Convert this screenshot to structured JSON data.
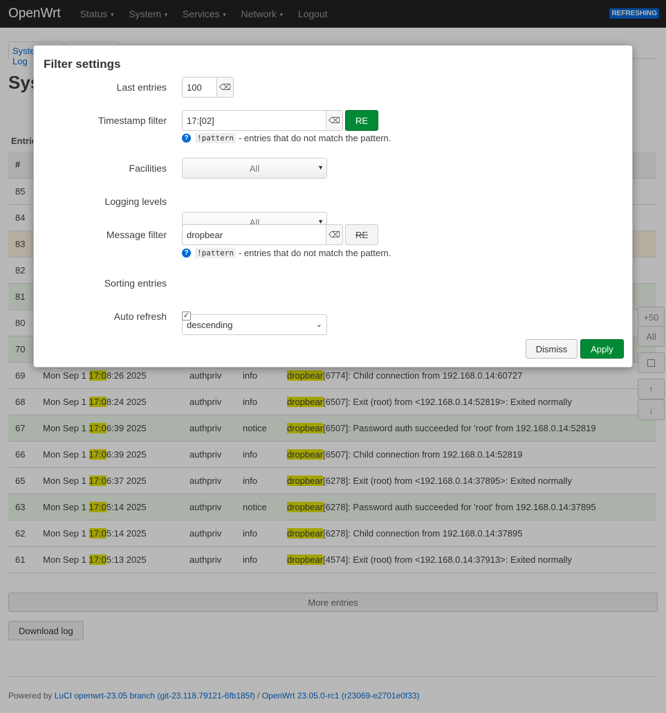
{
  "header": {
    "brand": "OpenWrt",
    "nav": [
      "Status",
      "System",
      "Services",
      "Network"
    ],
    "logout": "Logout",
    "badge": "REFRESHING"
  },
  "page": {
    "tabs": [
      "System Log",
      ""
    ],
    "title": "System Log",
    "entries_label": "Entries",
    "columns": [
      "#",
      "",
      "",
      "",
      ""
    ],
    "side_buttons": [
      "+50",
      "All",
      "",
      "↑",
      "↓"
    ],
    "more_entries": "More entries",
    "download": "Download log"
  },
  "log_rows": [
    {
      "id": "85",
      "kind": "info"
    },
    {
      "id": "84",
      "kind": "info"
    },
    {
      "id": "83",
      "kind": "warn"
    },
    {
      "id": "82",
      "kind": "info"
    },
    {
      "id": "81",
      "kind": "notice"
    },
    {
      "id": "80",
      "kind": "info"
    },
    {
      "id": "70",
      "kind": "notice"
    },
    {
      "id": "69",
      "kind": "info",
      "ts_pre": "Mon Sep 1 ",
      "ts_hl": "17:0",
      "ts_post": "8:26 2025",
      "facility": "authpriv",
      "level": "info",
      "msg_hl": "dropbear",
      "msg": "[6774]: Child connection from 192.168.0.14:60727"
    },
    {
      "id": "68",
      "kind": "info",
      "ts_pre": "Mon Sep 1 ",
      "ts_hl": "17:0",
      "ts_post": "8:24 2025",
      "facility": "authpriv",
      "level": "info",
      "msg_hl": "dropbear",
      "msg": "[6507]: Exit (root) from <192.168.0.14:52819>: Exited normally"
    },
    {
      "id": "67",
      "kind": "notice",
      "ts_pre": "Mon Sep 1 ",
      "ts_hl": "17:0",
      "ts_post": "6:39 2025",
      "facility": "authpriv",
      "level": "notice",
      "msg_hl": "dropbear",
      "msg": "[6507]: Password auth succeeded for 'root' from 192.168.0.14:52819"
    },
    {
      "id": "66",
      "kind": "info",
      "ts_pre": "Mon Sep 1 ",
      "ts_hl": "17:0",
      "ts_post": "6:39 2025",
      "facility": "authpriv",
      "level": "info",
      "msg_hl": "dropbear",
      "msg": "[6507]: Child connection from 192.168.0.14:52819"
    },
    {
      "id": "65",
      "kind": "info",
      "ts_pre": "Mon Sep 1 ",
      "ts_hl": "17:0",
      "ts_post": "6:37 2025",
      "facility": "authpriv",
      "level": "info",
      "msg_hl": "dropbear",
      "msg": "[6278]: Exit (root) from <192.168.0.14:37895>: Exited normally"
    },
    {
      "id": "63",
      "kind": "notice",
      "ts_pre": "Mon Sep 1 ",
      "ts_hl": "17:0",
      "ts_post": "5:14 2025",
      "facility": "authpriv",
      "level": "notice",
      "msg_hl": "dropbear",
      "msg": "[6278]: Password auth succeeded for 'root' from 192.168.0.14:37895"
    },
    {
      "id": "62",
      "kind": "info",
      "ts_pre": "Mon Sep 1 ",
      "ts_hl": "17:0",
      "ts_post": "5:14 2025",
      "facility": "authpriv",
      "level": "info",
      "msg_hl": "dropbear",
      "msg": "[6278]: Child connection from 192.168.0.14:37895"
    },
    {
      "id": "61",
      "kind": "info",
      "ts_pre": "Mon Sep 1 ",
      "ts_hl": "17:0",
      "ts_post": "5:13 2025",
      "facility": "authpriv",
      "level": "info",
      "msg_hl": "dropbear",
      "msg": "[4574]: Exit (root) from <192.168.0.14:37913>: Exited normally"
    }
  ],
  "footer": {
    "prefix": "Powered by ",
    "luci": "LuCI openwrt-23.05 branch (git-23.118.79121-6fb185f)",
    "sep": " / ",
    "openwrt": "OpenWrt 23.05.0-rc1 (r23069-e2701e0f33)"
  },
  "modal": {
    "title": "Filter settings",
    "last_entries": {
      "label": "Last entries",
      "value": "100"
    },
    "timestamp": {
      "label": "Timestamp filter",
      "value": "17:[02]",
      "re": "RE",
      "re_active": true
    },
    "hint": {
      "icon": "?",
      "code": "!pattern",
      "text": "- entries that do not match the pattern."
    },
    "facilities": {
      "label": "Facilities",
      "value": "All"
    },
    "levels": {
      "label": "Logging levels",
      "value": "All"
    },
    "message": {
      "label": "Message filter",
      "value": "dropbear",
      "re": "RE",
      "re_active": false
    },
    "sorting": {
      "label": "Sorting entries",
      "value": "descending"
    },
    "auto_refresh": {
      "label": "Auto refresh",
      "checked": true
    },
    "clear_glyph": "⌫",
    "dismiss": "Dismiss",
    "apply": "Apply"
  },
  "colors": {
    "accent": "#0069d6",
    "apply_green": "#008a36",
    "highlight": "#e2e200",
    "notice_row": "#eef7ea"
  }
}
